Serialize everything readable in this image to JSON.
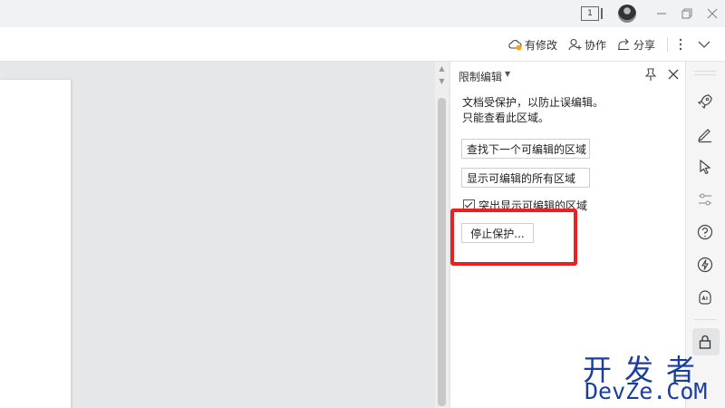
{
  "titlebar": {
    "window_count": "1",
    "icons": [
      "window-count-icon",
      "avatar",
      "minimize-icon",
      "restore-icon",
      "close-icon"
    ]
  },
  "toolbar": {
    "modified_label": "有修改",
    "collaborate_label": "协作",
    "share_label": "分享",
    "icons": [
      "cloud-warning-icon",
      "add-user-icon",
      "share-icon",
      "more-vertical-icon",
      "chevron-down-icon"
    ]
  },
  "panel": {
    "title": "限制编辑",
    "description_line1": "文档受保护，以防止误编辑。",
    "description_line2": "只能查看此区域。",
    "find_next_label": "查找下一个可编辑的区域",
    "show_all_label": "显示可编辑的所有区域",
    "highlight_label": "突出显示可编辑的区域",
    "highlight_checked": true,
    "stop_protection_label": "停止保护...",
    "highlight_box_color": "#ee1f1f"
  },
  "rightbar": {
    "icons": [
      "rocket-icon",
      "pen-icon",
      "cursor-icon",
      "adjust-icon",
      "help-icon",
      "lightning-icon",
      "ai-icon",
      "lock-icon"
    ]
  },
  "watermark": {
    "line1": "开发者",
    "line2": "DevZe.CoM",
    "color": "#1a3ea0"
  }
}
